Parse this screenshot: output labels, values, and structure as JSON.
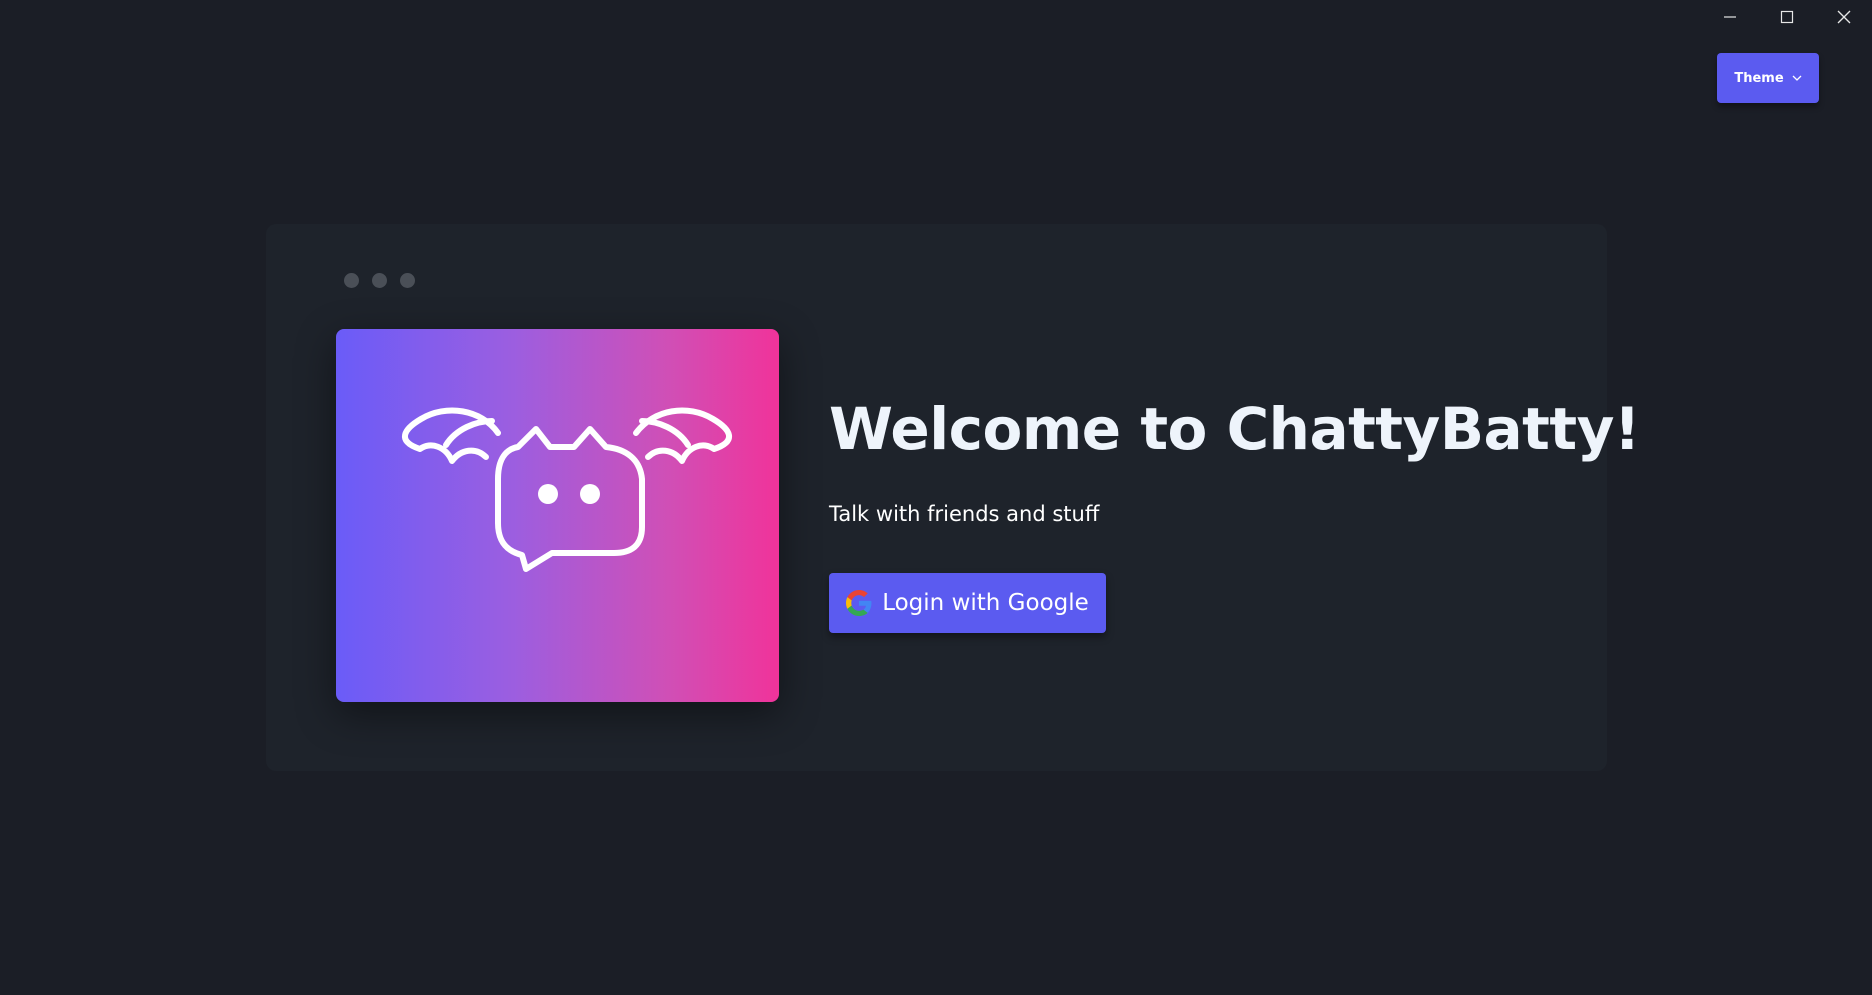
{
  "window": {
    "controls": [
      "minimize-icon",
      "maximize-icon",
      "close-icon"
    ]
  },
  "header": {
    "theme_label": "Theme",
    "theme_icon": "chevron-down-icon"
  },
  "card": {
    "logo_icon": "bat-chat-bubble-logo",
    "title": "Welcome to ChattyBatty!",
    "subtitle": "Talk with friends and stuff",
    "login_label": "Login with Google",
    "login_icon": "google-g-icon"
  },
  "colors": {
    "background": "#1b1e26",
    "card": "#1e232b",
    "accent": "#5b5bf0",
    "gradient_start": "#6a5cf8",
    "gradient_end": "#f0339a"
  }
}
